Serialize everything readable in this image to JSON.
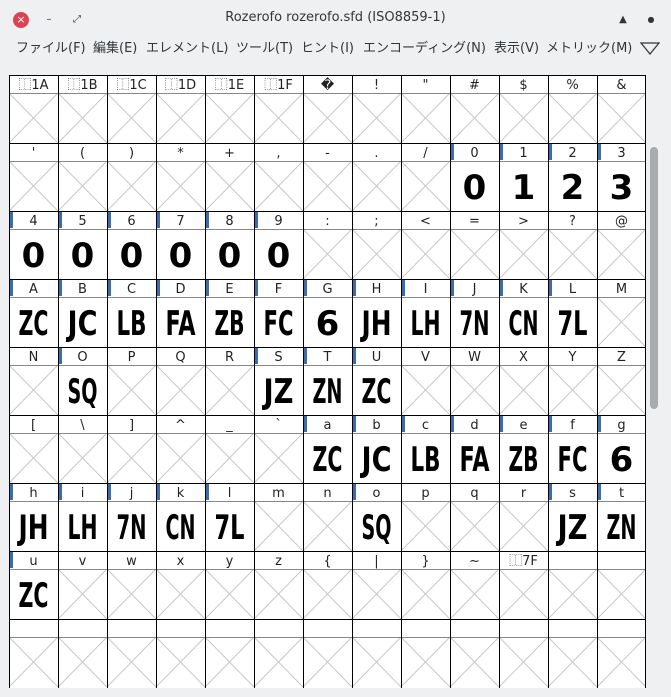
{
  "window": {
    "title": "Rozerofo rozerofo.sfd (ISO8859-1)",
    "close_glyph": "×",
    "minimize_glyph": "–",
    "maximize_glyph": "⤢",
    "up_glyph": "▲",
    "pin_glyph": "●"
  },
  "menu": [
    "ファイル(F)",
    "編集(E)",
    "エレメント(L)",
    "ツール(T)",
    "ヒント(I)",
    "エンコーディング(N)",
    "表示(V)",
    "メトリック(M)"
  ],
  "grid": {
    "rows": [
      {
        "labels": [
          "⿰1A",
          "⿰1B",
          "⿰1C",
          "⿰1D",
          "⿰1E",
          "⿰1F",
          "�",
          "!",
          "\"",
          "#",
          "$",
          "%",
          "&"
        ],
        "glyphs": [
          "",
          "",
          "",
          "",
          "",
          "",
          "",
          "",
          "",
          "",
          "",
          "",
          ""
        ],
        "marked": [
          false,
          false,
          false,
          false,
          false,
          false,
          false,
          false,
          false,
          false,
          false,
          false,
          false
        ]
      },
      {
        "labels": [
          "'",
          "(",
          ")",
          "*",
          "+",
          ",",
          "-",
          ".",
          "/",
          "0",
          "1",
          "2",
          "3"
        ],
        "glyphs": [
          "",
          "",
          "",
          "",
          "",
          "",
          "",
          "",
          "",
          "0",
          "1",
          "2",
          "3"
        ],
        "marked": [
          false,
          false,
          false,
          false,
          false,
          false,
          false,
          false,
          false,
          true,
          true,
          true,
          true
        ]
      },
      {
        "labels": [
          "4",
          "5",
          "6",
          "7",
          "8",
          "9",
          ":",
          ";",
          "<",
          "=",
          ">",
          "?",
          "@"
        ],
        "glyphs": [
          "0",
          "0",
          "0",
          "0",
          "0",
          "0",
          "",
          "",
          "",
          "",
          "",
          "",
          ""
        ],
        "marked": [
          true,
          true,
          true,
          true,
          true,
          true,
          false,
          false,
          false,
          false,
          false,
          false,
          false
        ]
      },
      {
        "labels": [
          "A",
          "B",
          "C",
          "D",
          "E",
          "F",
          "G",
          "H",
          "I",
          "J",
          "K",
          "L",
          "M"
        ],
        "glyphs": [
          "ZC",
          "JC",
          "LB",
          "FA",
          "ZB",
          "FC",
          "6",
          "JH",
          "LH",
          "7N",
          "CN",
          "7L",
          ""
        ],
        "marked": [
          true,
          true,
          true,
          true,
          true,
          true,
          true,
          true,
          true,
          true,
          true,
          true,
          false
        ]
      },
      {
        "labels": [
          "N",
          "O",
          "P",
          "Q",
          "R",
          "S",
          "T",
          "U",
          "V",
          "W",
          "X",
          "Y",
          "Z"
        ],
        "glyphs": [
          "",
          "SQ",
          "",
          "",
          "",
          "JZ",
          "ZN",
          "ZC",
          "",
          "",
          "",
          "",
          ""
        ],
        "marked": [
          false,
          true,
          false,
          false,
          false,
          true,
          true,
          true,
          false,
          false,
          false,
          false,
          false
        ]
      },
      {
        "labels": [
          "[",
          "\\",
          "]",
          "^",
          "_",
          "`",
          "a",
          "b",
          "c",
          "d",
          "e",
          "f",
          "g"
        ],
        "glyphs": [
          "",
          "",
          "",
          "",
          "",
          "",
          "ZC",
          "JC",
          "LB",
          "FA",
          "ZB",
          "FC",
          "6"
        ],
        "marked": [
          false,
          false,
          false,
          false,
          false,
          false,
          true,
          true,
          true,
          true,
          true,
          true,
          true
        ]
      },
      {
        "labels": [
          "h",
          "i",
          "j",
          "k",
          "l",
          "m",
          "n",
          "o",
          "p",
          "q",
          "r",
          "s",
          "t"
        ],
        "glyphs": [
          "JH",
          "LH",
          "7N",
          "CN",
          "7L",
          "",
          "",
          "SQ",
          "",
          "",
          "",
          "JZ",
          "ZN"
        ],
        "marked": [
          true,
          true,
          true,
          true,
          true,
          false,
          false,
          true,
          false,
          false,
          false,
          true,
          true
        ]
      },
      {
        "labels": [
          "u",
          "v",
          "w",
          "x",
          "y",
          "z",
          "{",
          "|",
          "}",
          "~",
          "⿰7F",
          "",
          ""
        ],
        "glyphs": [
          "ZC",
          "",
          "",
          "",
          "",
          "",
          "",
          "",
          "",
          "",
          "",
          "",
          ""
        ],
        "marked": [
          true,
          false,
          false,
          false,
          false,
          false,
          false,
          false,
          false,
          false,
          false,
          false,
          false
        ]
      },
      {
        "labels": [
          "",
          "",
          "",
          "",
          "",
          "",
          "",
          "",
          "",
          "",
          "",
          "",
          ""
        ],
        "glyphs": [
          "",
          "",
          "",
          "",
          "",
          "",
          "",
          "",
          "",
          "",
          "",
          "",
          ""
        ],
        "marked": [
          false,
          false,
          false,
          false,
          false,
          false,
          false,
          false,
          false,
          false,
          false,
          false,
          false
        ]
      }
    ]
  },
  "colors": {
    "chrome": "#eff0f1",
    "text": "#31363b",
    "close": "#da4453",
    "marker": "#3b6ea8",
    "grid_line": "#000000",
    "empty_cross": "#c8c8c8",
    "thumb": "#a9acaf"
  },
  "scroll": {
    "position_fraction": 0.0,
    "visible_fraction": 0.43
  }
}
